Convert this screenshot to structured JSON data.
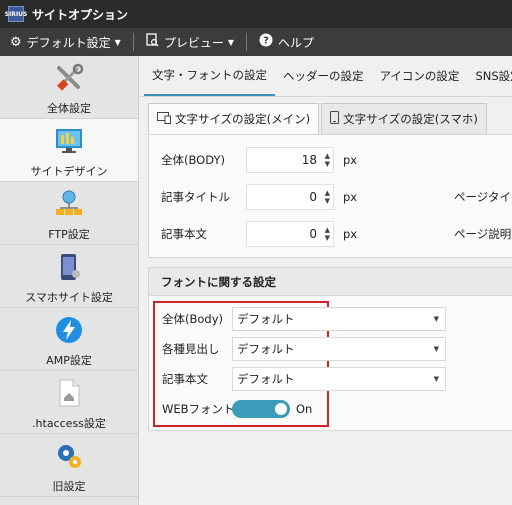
{
  "app": {
    "title": "サイトオプション",
    "icon_text": "SIRIUS"
  },
  "toolbar": {
    "default_settings": "デフォルト設定",
    "preview": "プレビュー",
    "help": "ヘルプ"
  },
  "sidebar": {
    "items": [
      {
        "label": "全体設定",
        "icon": "tools-icon"
      },
      {
        "label": "サイトデザイン",
        "icon": "site-design-icon"
      },
      {
        "label": "FTP設定",
        "icon": "network-icon"
      },
      {
        "label": "スマホサイト設定",
        "icon": "smartphone-icon"
      },
      {
        "label": "AMP設定",
        "icon": "amp-bolt-icon"
      },
      {
        "label": ".htaccess設定",
        "icon": "htaccess-file-icon"
      },
      {
        "label": "旧設定",
        "icon": "gears-icon"
      }
    ],
    "active_index": 1
  },
  "tabs": [
    "文字・フォントの設定",
    "ヘッダーの設定",
    "アイコンの設定",
    "SNS設定"
  ],
  "subtabs": [
    "文字サイズの設定(メイン)",
    "文字サイズの設定(スマホ)"
  ],
  "size_settings": {
    "body_label": "全体(BODY)",
    "body_value": "18",
    "article_title_label": "記事タイトル",
    "article_title_value": "0",
    "article_body_label": "記事本文",
    "article_body_value": "0",
    "unit": "px",
    "page_title_label": "ページタイトル",
    "page_desc_label": "ページ説明文"
  },
  "font_settings": {
    "header": "フォントに関する設定",
    "body_label": "全体(Body)",
    "body_value": "デフォルト",
    "headings_label": "各種見出し",
    "headings_value": "デフォルト",
    "article_label": "記事本文",
    "article_value": "デフォルト",
    "web_font_label": "WEBフォント",
    "web_font_state": "On"
  },
  "colors": {
    "accent": "#3a9cb8",
    "highlight": "#d0202a",
    "titlebar": "#2b2b2b",
    "toolbar": "#3c3c3c"
  }
}
